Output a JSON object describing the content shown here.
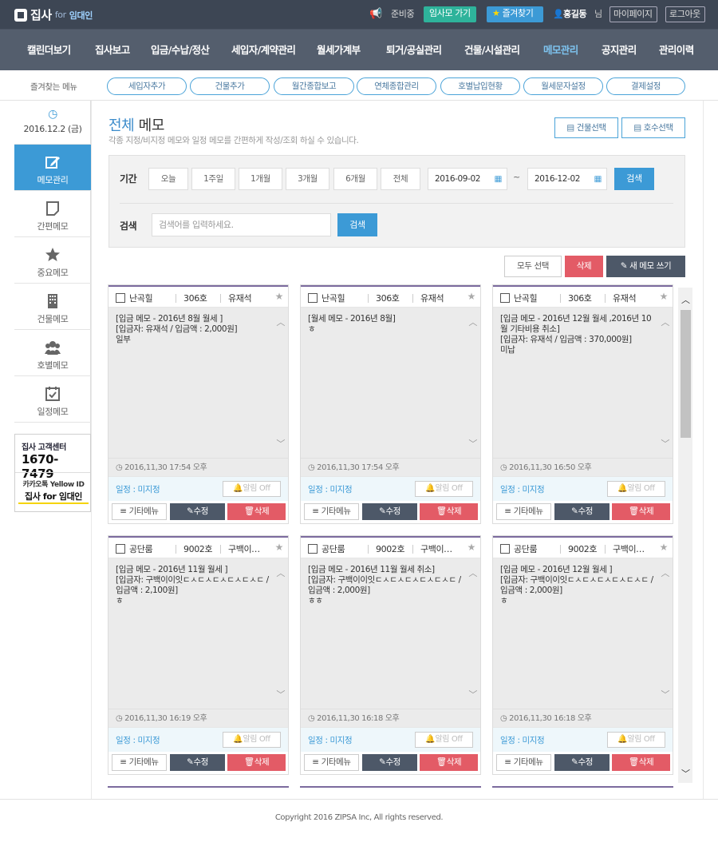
{
  "topbar": {
    "logo": "집사",
    "logo_for": "for",
    "logo_sub": "임대인",
    "status_text": "준비중",
    "go_btn": "임사모 가기",
    "fav_btn": "즐겨찾기",
    "user": "홍길동",
    "user_suffix": "님",
    "mypage": "마이페이지",
    "logout": "로그아웃"
  },
  "nav": [
    "캘린더보기",
    "집사보고",
    "입금/수납/정산",
    "세입자/계약관리",
    "월세가계부",
    "퇴거/공실관리",
    "건물/시설관리",
    "메모관리",
    "공지관리",
    "관리이력"
  ],
  "favorites": {
    "label": "즐겨찾는 메뉴",
    "items": [
      "세입자추가",
      "건물추가",
      "월간종합보고",
      "연체종합관리",
      "호별납입현황",
      "월세문자설정",
      "결제설정"
    ]
  },
  "sidebar": {
    "date": "2016.12.2 (금)",
    "items": [
      "메모관리",
      "간편메모",
      "중요메모",
      "건물메모",
      "호별메모",
      "일정메모"
    ],
    "cs_title": "집사 고객센터",
    "cs_phone": "1670-7479",
    "kakao_line1": "카카오톡 Yellow ID",
    "kakao_line2": "집사 for 임대인"
  },
  "page": {
    "title_blue": "전체",
    "title": "메모",
    "desc": "각종 지정/비지정 메모와 일정 메모를 간편하게 작성/조회 하실 수 있습니다.",
    "building_btn": "건물선택",
    "unit_btn": "호수선택"
  },
  "filter": {
    "period_label": "기간",
    "periods": [
      "오늘",
      "1주일",
      "1개월",
      "3개월",
      "6개월",
      "전체"
    ],
    "date_from": "2016-09-02",
    "tilde": "~",
    "date_to": "2016-12-02",
    "search_btn": "검색",
    "search_label": "검색",
    "search_placeholder": "검색어를 입력하세요.",
    "search_btn2": "검색"
  },
  "actions": {
    "select_all": "모두 선택",
    "delete": "삭제",
    "new_memo": "새 메모 쓰기"
  },
  "card_labels": {
    "schedule": "일정 : 미지정",
    "alarm": "알림 Off",
    "etc": "기타메뉴",
    "edit": "수정",
    "delete": "삭제"
  },
  "cards": [
    {
      "building": "난곡힐",
      "unit": "306호",
      "tenant": "유재석",
      "text": "[입금 메모 - 2016년 8월 월세 ]\n[입금자: 유재석 / 입금액 : 2,000원]\n일부",
      "time": "2016,11,30 17:54 오후"
    },
    {
      "building": "난곡힐",
      "unit": "306호",
      "tenant": "유재석",
      "text": "[월세 메모 - 2016년 8월]\nㅎ",
      "time": "2016,11,30 17:54 오후"
    },
    {
      "building": "난곡힐",
      "unit": "306호",
      "tenant": "유재석",
      "text": "[입금 메모 - 2016년 12월 월세 ,2016년 10월 기타비용 취소]\n[입금자: 유재석 / 입금액 : 370,000원]\n미납",
      "time": "2016,11,30 16:50 오후"
    },
    {
      "building": "공단룸",
      "unit": "9002호",
      "tenant": "구백이…",
      "text": "[입금 메모 - 2016년 11월 월세 ]\n[입금자: 구백이이잇ㄷㅅㄷㅅㄷㅅㄷㅅㄷㅅㄷ / 입금액 : 2,100원]\nㅎ",
      "time": "2016,11,30 16:19 오후"
    },
    {
      "building": "공단룸",
      "unit": "9002호",
      "tenant": "구백이…",
      "text": "[입금 메모 - 2016년 11월 월세 취소]\n[입금자: 구백이이잇ㄷㅅㄷㅅㄷㅅㄷㅅㄷㅅㄷ / 입금액 : 2,000원]\nㅎㅎ",
      "time": "2016,11,30 16:18 오후"
    },
    {
      "building": "공단룸",
      "unit": "9002호",
      "tenant": "구백이…",
      "text": "[입금 메모 - 2016년 12월 월세 ]\n[입금자: 구백이이잇ㄷㅅㄷㅅㄷㅅㄷㅅㄷㅅㄷ / 입금액 : 2,000원]\nㅎ",
      "time": "2016,11,30 16:18 오후"
    }
  ],
  "footer": {
    "copyright": "Copyright 2016 ZIPSA Inc, All rights reserved."
  },
  "colors": {
    "accent": "#3c9ad6",
    "delete": "#e35b66",
    "nav": "#545e6d",
    "topbar": "#3d4654"
  }
}
